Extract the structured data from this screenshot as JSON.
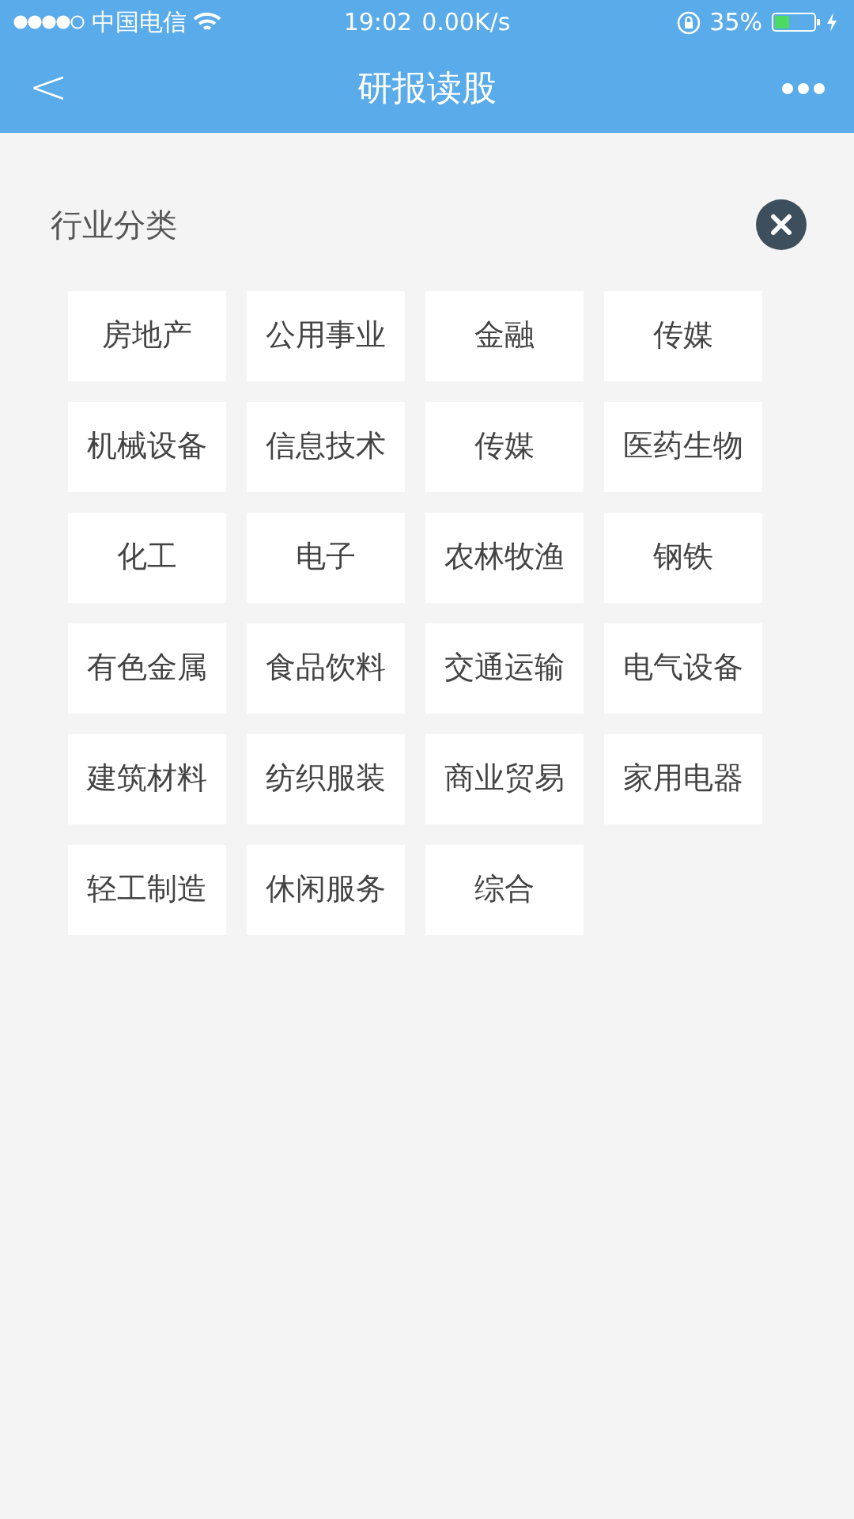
{
  "status_bar": {
    "carrier": "中国电信",
    "time": "19:02",
    "speed": "0.00K/s",
    "battery": "35%"
  },
  "nav": {
    "back": "<",
    "title": "研报读股"
  },
  "section": {
    "title": "行业分类"
  },
  "categories": [
    "房地产",
    "公用事业",
    "金融",
    "传媒",
    "机械设备",
    "信息技术",
    "传媒",
    "医药生物",
    "化工",
    "电子",
    "农林牧渔",
    "钢铁",
    "有色金属",
    "食品饮料",
    "交通运输",
    "电气设备",
    "建筑材料",
    "纺织服装",
    "商业贸易",
    "家用电器",
    "轻工制造",
    "休闲服务",
    "综合"
  ]
}
